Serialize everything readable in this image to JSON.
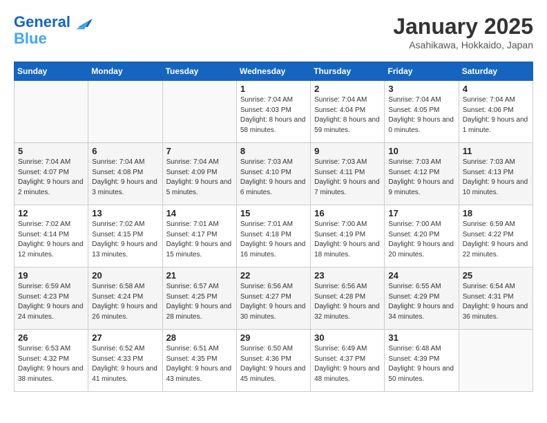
{
  "header": {
    "logo_line1": "General",
    "logo_line2": "Blue",
    "month_title": "January 2025",
    "location": "Asahikawa, Hokkaido, Japan"
  },
  "weekdays": [
    "Sunday",
    "Monday",
    "Tuesday",
    "Wednesday",
    "Thursday",
    "Friday",
    "Saturday"
  ],
  "weeks": [
    [
      {
        "day": "",
        "info": ""
      },
      {
        "day": "",
        "info": ""
      },
      {
        "day": "",
        "info": ""
      },
      {
        "day": "1",
        "info": "Sunrise: 7:04 AM\nSunset: 4:03 PM\nDaylight: 8 hours and 58 minutes."
      },
      {
        "day": "2",
        "info": "Sunrise: 7:04 AM\nSunset: 4:04 PM\nDaylight: 8 hours and 59 minutes."
      },
      {
        "day": "3",
        "info": "Sunrise: 7:04 AM\nSunset: 4:05 PM\nDaylight: 9 hours and 0 minutes."
      },
      {
        "day": "4",
        "info": "Sunrise: 7:04 AM\nSunset: 4:06 PM\nDaylight: 9 hours and 1 minute."
      }
    ],
    [
      {
        "day": "5",
        "info": "Sunrise: 7:04 AM\nSunset: 4:07 PM\nDaylight: 9 hours and 2 minutes."
      },
      {
        "day": "6",
        "info": "Sunrise: 7:04 AM\nSunset: 4:08 PM\nDaylight: 9 hours and 3 minutes."
      },
      {
        "day": "7",
        "info": "Sunrise: 7:04 AM\nSunset: 4:09 PM\nDaylight: 9 hours and 5 minutes."
      },
      {
        "day": "8",
        "info": "Sunrise: 7:03 AM\nSunset: 4:10 PM\nDaylight: 9 hours and 6 minutes."
      },
      {
        "day": "9",
        "info": "Sunrise: 7:03 AM\nSunset: 4:11 PM\nDaylight: 9 hours and 7 minutes."
      },
      {
        "day": "10",
        "info": "Sunrise: 7:03 AM\nSunset: 4:12 PM\nDaylight: 9 hours and 9 minutes."
      },
      {
        "day": "11",
        "info": "Sunrise: 7:03 AM\nSunset: 4:13 PM\nDaylight: 9 hours and 10 minutes."
      }
    ],
    [
      {
        "day": "12",
        "info": "Sunrise: 7:02 AM\nSunset: 4:14 PM\nDaylight: 9 hours and 12 minutes."
      },
      {
        "day": "13",
        "info": "Sunrise: 7:02 AM\nSunset: 4:15 PM\nDaylight: 9 hours and 13 minutes."
      },
      {
        "day": "14",
        "info": "Sunrise: 7:01 AM\nSunset: 4:17 PM\nDaylight: 9 hours and 15 minutes."
      },
      {
        "day": "15",
        "info": "Sunrise: 7:01 AM\nSunset: 4:18 PM\nDaylight: 9 hours and 16 minutes."
      },
      {
        "day": "16",
        "info": "Sunrise: 7:00 AM\nSunset: 4:19 PM\nDaylight: 9 hours and 18 minutes."
      },
      {
        "day": "17",
        "info": "Sunrise: 7:00 AM\nSunset: 4:20 PM\nDaylight: 9 hours and 20 minutes."
      },
      {
        "day": "18",
        "info": "Sunrise: 6:59 AM\nSunset: 4:22 PM\nDaylight: 9 hours and 22 minutes."
      }
    ],
    [
      {
        "day": "19",
        "info": "Sunrise: 6:59 AM\nSunset: 4:23 PM\nDaylight: 9 hours and 24 minutes."
      },
      {
        "day": "20",
        "info": "Sunrise: 6:58 AM\nSunset: 4:24 PM\nDaylight: 9 hours and 26 minutes."
      },
      {
        "day": "21",
        "info": "Sunrise: 6:57 AM\nSunset: 4:25 PM\nDaylight: 9 hours and 28 minutes."
      },
      {
        "day": "22",
        "info": "Sunrise: 6:56 AM\nSunset: 4:27 PM\nDaylight: 9 hours and 30 minutes."
      },
      {
        "day": "23",
        "info": "Sunrise: 6:56 AM\nSunset: 4:28 PM\nDaylight: 9 hours and 32 minutes."
      },
      {
        "day": "24",
        "info": "Sunrise: 6:55 AM\nSunset: 4:29 PM\nDaylight: 9 hours and 34 minutes."
      },
      {
        "day": "25",
        "info": "Sunrise: 6:54 AM\nSunset: 4:31 PM\nDaylight: 9 hours and 36 minutes."
      }
    ],
    [
      {
        "day": "26",
        "info": "Sunrise: 6:53 AM\nSunset: 4:32 PM\nDaylight: 9 hours and 38 minutes."
      },
      {
        "day": "27",
        "info": "Sunrise: 6:52 AM\nSunset: 4:33 PM\nDaylight: 9 hours and 41 minutes."
      },
      {
        "day": "28",
        "info": "Sunrise: 6:51 AM\nSunset: 4:35 PM\nDaylight: 9 hours and 43 minutes."
      },
      {
        "day": "29",
        "info": "Sunrise: 6:50 AM\nSunset: 4:36 PM\nDaylight: 9 hours and 45 minutes."
      },
      {
        "day": "30",
        "info": "Sunrise: 6:49 AM\nSunset: 4:37 PM\nDaylight: 9 hours and 48 minutes."
      },
      {
        "day": "31",
        "info": "Sunrise: 6:48 AM\nSunset: 4:39 PM\nDaylight: 9 hours and 50 minutes."
      },
      {
        "day": "",
        "info": ""
      }
    ]
  ]
}
